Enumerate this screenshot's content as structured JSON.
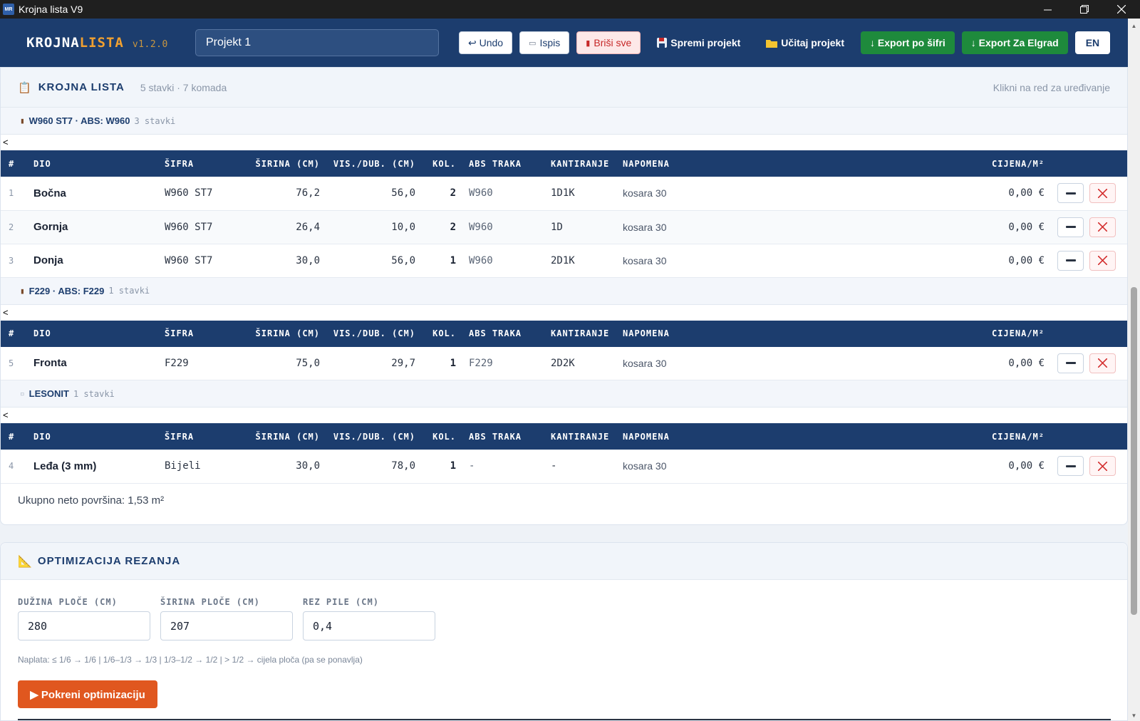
{
  "window": {
    "title": "Krojna lista V9",
    "icon_text": "MR"
  },
  "header": {
    "brand_main": "KROJNA",
    "brand_accent": "LISTA",
    "version": "v1.2.0",
    "project_name": "Projekt 1",
    "buttons": {
      "undo": "↩ Undo",
      "print": "Ispis",
      "delete_all": "Briši sve",
      "save": "Spremi projekt",
      "load": "Učitaj projekt",
      "export_code": "↓ Export po šifri",
      "export_elgrad": "↓ Export Za Elgrad",
      "lang": "EN"
    }
  },
  "list": {
    "title": "KROJNA LISTA",
    "subtitle": "5 stavki · 7 komada",
    "hint": "Klikni na red za uređivanje",
    "columns": [
      "#",
      "DIO",
      "ŠIFRA",
      "ŠIRINA (CM)",
      "VIS./DUB. (CM)",
      "KOL.",
      "ABS TRAKA",
      "KANTIRANJE",
      "NAPOMENA",
      "CIJENA/M²"
    ],
    "groups": [
      {
        "name": "W960 ST7 · ABS: W960",
        "count": "3 stavki",
        "lt": "<",
        "rows": [
          {
            "num": "1",
            "dio": "Bočna",
            "sifra": "W960 ST7",
            "sirina": "76,2",
            "visina": "56,0",
            "kol": "2",
            "abs": "W960",
            "kant": "1D1K",
            "napomena": "kosara 30",
            "cijena": "0,00 €"
          },
          {
            "num": "2",
            "dio": "Gornja",
            "sifra": "W960 ST7",
            "sirina": "26,4",
            "visina": "10,0",
            "kol": "2",
            "abs": "W960",
            "kant": "1D",
            "napomena": "kosara 30",
            "cijena": "0,00 €"
          },
          {
            "num": "3",
            "dio": "Donja",
            "sifra": "W960 ST7",
            "sirina": "30,0",
            "visina": "56,0",
            "kol": "1",
            "abs": "W960",
            "kant": "2D1K",
            "napomena": "kosara 30",
            "cijena": "0,00 €"
          }
        ]
      },
      {
        "name": "F229 · ABS: F229",
        "count": "1 stavki",
        "lt": "<",
        "rows": [
          {
            "num": "5",
            "dio": "Fronta",
            "sifra": "F229",
            "sirina": "75,0",
            "visina": "29,7",
            "kol": "1",
            "abs": "F229",
            "kant": "2D2K",
            "napomena": "kosara 30",
            "cijena": "0,00 €"
          }
        ]
      },
      {
        "name": "LESONIT",
        "count": "1 stavki",
        "lt": "<",
        "rows": [
          {
            "num": "4",
            "dio": "Leđa (3 mm)",
            "sifra": "Bijeli",
            "sirina": "30,0",
            "visina": "78,0",
            "kol": "1",
            "abs": "-",
            "kant": "-",
            "napomena": "kosara 30",
            "cijena": "0,00 €"
          }
        ]
      }
    ],
    "total": "Ukupno neto površina: 1,53 m²"
  },
  "optimization": {
    "title": "OPTIMIZACIJA REZANJA",
    "fields": {
      "length_label": "DUŽINA PLOČE (CM)",
      "length_value": "280",
      "width_label": "ŠIRINA PLOČE (CM)",
      "width_value": "207",
      "kerf_label": "REZ PILE (CM)",
      "kerf_value": "0,4"
    },
    "naplata": "Naplata: ≤ 1/6 → 1/6  |  1/6–1/3 → 1/3  |  1/3–1/2 → 1/2  |  > 1/2 → cijela ploča (pa se ponavlja)",
    "run_button": "▶ Pokreni optimizaciju"
  }
}
